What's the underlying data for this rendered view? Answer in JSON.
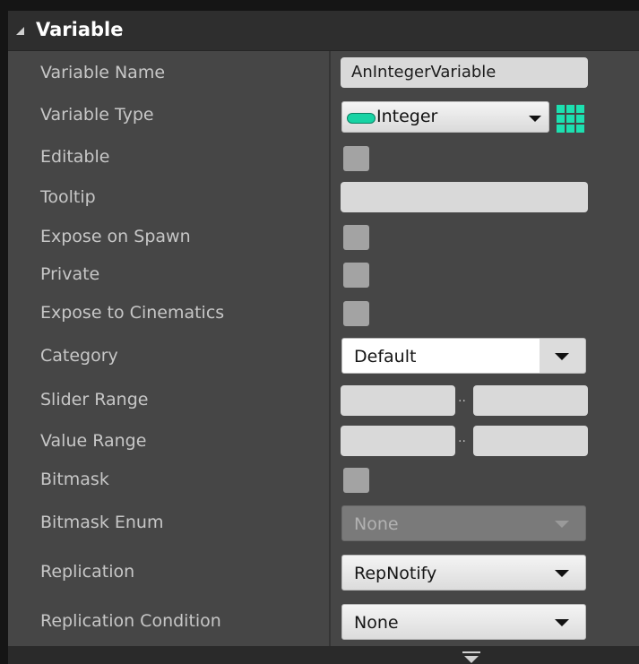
{
  "section": {
    "title": "Variable"
  },
  "fields": {
    "variable_name": {
      "label": "Variable Name",
      "value": "AnIntegerVariable"
    },
    "variable_type": {
      "label": "Variable Type",
      "value": "Integer",
      "pill_color": "#17d3a4",
      "grid_icon": "variable-container-grid-icon"
    },
    "editable": {
      "label": "Editable",
      "checked": false
    },
    "tooltip": {
      "label": "Tooltip",
      "value": ""
    },
    "expose_on_spawn": {
      "label": "Expose on Spawn",
      "checked": false
    },
    "private": {
      "label": "Private",
      "checked": false
    },
    "expose_to_cinematics": {
      "label": "Expose to Cinematics",
      "checked": false
    },
    "category": {
      "label": "Category",
      "value": "Default"
    },
    "slider_range": {
      "label": "Slider Range",
      "separator": "..",
      "min": "",
      "max": ""
    },
    "value_range": {
      "label": "Value Range",
      "separator": "..",
      "min": "",
      "max": ""
    },
    "bitmask": {
      "label": "Bitmask",
      "checked": false
    },
    "bitmask_enum": {
      "label": "Bitmask Enum",
      "value": "None",
      "disabled": true
    },
    "replication": {
      "label": "Replication",
      "value": "RepNotify"
    },
    "replication_condition": {
      "label": "Replication Condition",
      "value": "None"
    }
  },
  "colors": {
    "panel_bg": "#464646",
    "header_bg": "#2e2e2e",
    "accent": "#1de0b0"
  }
}
